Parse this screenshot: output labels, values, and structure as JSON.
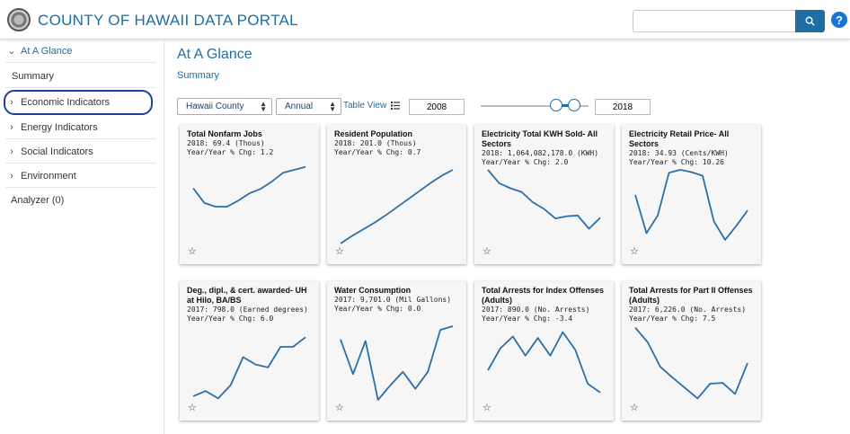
{
  "header": {
    "title": "COUNTY OF HAWAII DATA PORTAL",
    "search_placeholder": "",
    "help_label": "?"
  },
  "sidebar": {
    "at_a_glance": "At A Glance",
    "summary": "Summary",
    "economic": "Economic Indicators",
    "energy": "Energy Indicators",
    "social": "Social Indicators",
    "environment": "Environment",
    "analyzer": "Analyzer (0)"
  },
  "main": {
    "title": "At A Glance",
    "summary_link": "Summary",
    "geo_select": "Hawaii County",
    "freq_select": "Annual",
    "table_view": "Table View",
    "year_start": "2008",
    "year_end": "2018",
    "slider_range_fraction": [
      0.69,
      0.86
    ]
  },
  "cards": [
    {
      "title": "Total Nonfarm Jobs",
      "value": "2018: 69.4 (Thous)",
      "chg": "Year/Year % Chg: 1.2",
      "trend": [
        0.75,
        0.55,
        0.5,
        0.5,
        0.58,
        0.68,
        0.74,
        0.84,
        0.96,
        1.0,
        1.04
      ]
    },
    {
      "title": "Resident Population",
      "value": "2018: 201.0 (Thous)",
      "chg": "Year/Year % Chg: 0.7",
      "trend": [
        0.0,
        0.1,
        0.19,
        0.28,
        0.38,
        0.49,
        0.6,
        0.71,
        0.82,
        0.92,
        1.0
      ]
    },
    {
      "title": "Electricity Total KWH Sold- All Sectors",
      "value": "2018: 1,064,082,178.0 (KWH)",
      "chg": "Year/Year % Chg: 2.0",
      "trend": [
        1.0,
        0.82,
        0.75,
        0.7,
        0.56,
        0.47,
        0.34,
        0.37,
        0.38,
        0.2,
        0.35
      ]
    },
    {
      "title": "Electricity Retail Price- All Sectors",
      "value": "2018: 34.93 (Cents/KWH)",
      "chg": "Year/Year % Chg: 10.26",
      "trend": [
        0.66,
        0.14,
        0.38,
        0.96,
        1.0,
        0.97,
        0.92,
        0.3,
        0.05,
        0.24,
        0.45
      ]
    },
    {
      "title": "Deg., dipl., & cert. awarded- UH at Hilo, BA/BS",
      "value": "2017: 798.0 (Earned degrees)",
      "chg": "Year/Year % Chg: 6.0",
      "trend": [
        0.05,
        0.12,
        0.02,
        0.2,
        0.58,
        0.48,
        0.44,
        0.72,
        0.72,
        0.85
      ]
    },
    {
      "title": "Water Consumption",
      "value": "2017: 9,701.0 (Mil Gallons)",
      "chg": "Year/Year % Chg: 0.0",
      "trend": [
        0.82,
        0.35,
        0.8,
        0.0,
        0.2,
        0.38,
        0.15,
        0.38,
        0.95,
        1.0
      ]
    },
    {
      "title": "Total Arrests for Index Offenses (Adults)",
      "value": "2017: 890.0 (No. Arrests)",
      "chg": "Year/Year % Chg: -3.4",
      "trend": [
        0.4,
        0.7,
        0.86,
        0.6,
        0.84,
        0.6,
        0.92,
        0.68,
        0.22,
        0.1
      ]
    },
    {
      "title": "Total Arrests for Part II Offenses (Adults)",
      "value": "2017: 6,226.0 (No. Arrests)",
      "chg": "Year/Year % Chg: 7.5",
      "trend": [
        0.98,
        0.78,
        0.45,
        0.3,
        0.16,
        0.02,
        0.22,
        0.23,
        0.08,
        0.5
      ]
    }
  ],
  "colors": {
    "accent": "#1f6da1",
    "line": "#2b6fa8",
    "focus_ring": "#1c3fa0"
  }
}
